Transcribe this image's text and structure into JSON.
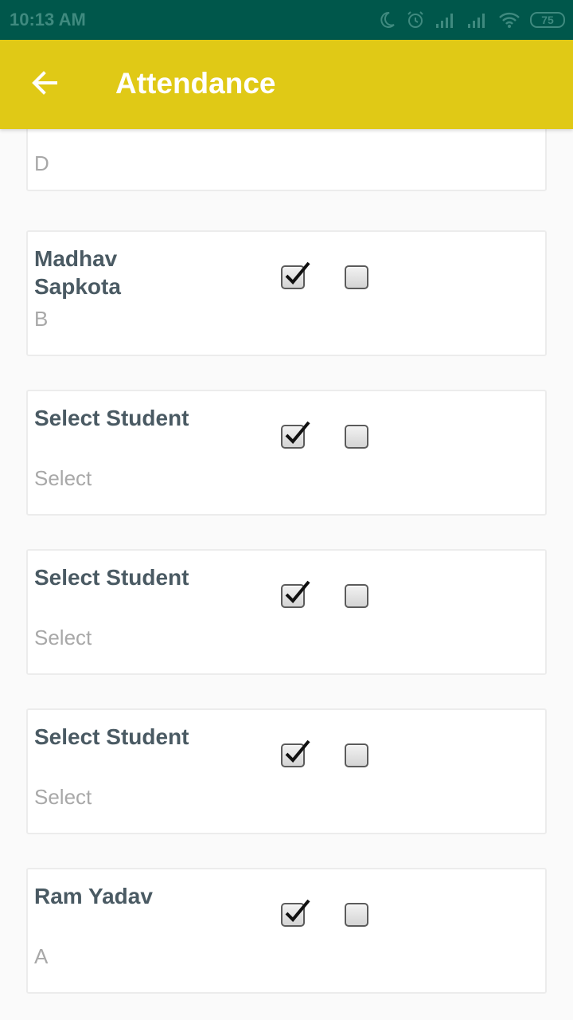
{
  "status_bar": {
    "time": "10:13 AM",
    "battery": "75",
    "icons": [
      "moon-icon",
      "alarm-icon",
      "signal-icon",
      "signal-icon",
      "wifi-icon",
      "battery-icon"
    ]
  },
  "app_bar": {
    "title": "Attendance",
    "back_icon": "arrow-back-icon"
  },
  "colors": {
    "status_bar": "#00574b",
    "app_bar": "#e0c916",
    "name_text": "#4a5a63",
    "sub_text": "#a8a8a8"
  },
  "students": [
    {
      "name": "",
      "sub": "D",
      "present": true,
      "absent": false
    },
    {
      "name": "Madhav Sapkota",
      "sub": "B",
      "present": true,
      "absent": false
    },
    {
      "name": "Select Student",
      "sub": "Select",
      "present": true,
      "absent": false
    },
    {
      "name": "Select Student",
      "sub": "Select",
      "present": true,
      "absent": false
    },
    {
      "name": "Select Student",
      "sub": "Select",
      "present": true,
      "absent": false
    },
    {
      "name": "Ram Yadav",
      "sub": "A",
      "present": true,
      "absent": false
    }
  ]
}
